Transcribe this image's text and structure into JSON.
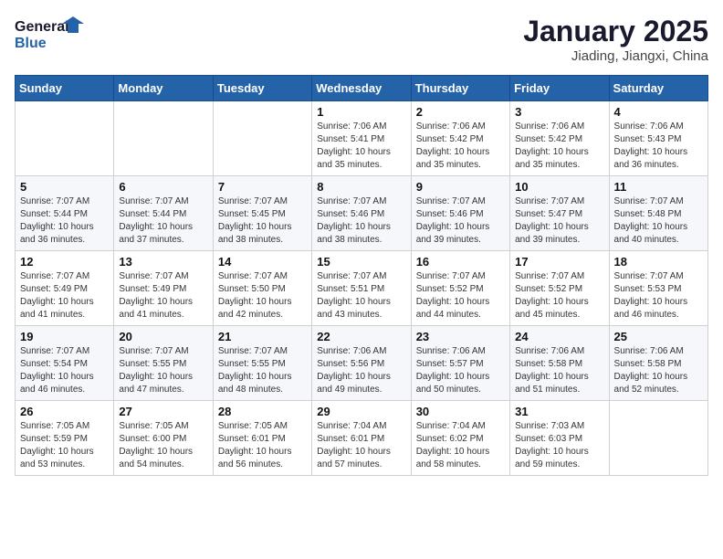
{
  "header": {
    "logo_line1": "General",
    "logo_line2": "Blue",
    "title": "January 2025",
    "subtitle": "Jiading, Jiangxi, China"
  },
  "weekdays": [
    "Sunday",
    "Monday",
    "Tuesday",
    "Wednesday",
    "Thursday",
    "Friday",
    "Saturday"
  ],
  "weeks": [
    [
      {
        "day": "",
        "sunrise": "",
        "sunset": "",
        "daylight": ""
      },
      {
        "day": "",
        "sunrise": "",
        "sunset": "",
        "daylight": ""
      },
      {
        "day": "",
        "sunrise": "",
        "sunset": "",
        "daylight": ""
      },
      {
        "day": "1",
        "sunrise": "Sunrise: 7:06 AM",
        "sunset": "Sunset: 5:41 PM",
        "daylight": "Daylight: 10 hours and 35 minutes."
      },
      {
        "day": "2",
        "sunrise": "Sunrise: 7:06 AM",
        "sunset": "Sunset: 5:42 PM",
        "daylight": "Daylight: 10 hours and 35 minutes."
      },
      {
        "day": "3",
        "sunrise": "Sunrise: 7:06 AM",
        "sunset": "Sunset: 5:42 PM",
        "daylight": "Daylight: 10 hours and 35 minutes."
      },
      {
        "day": "4",
        "sunrise": "Sunrise: 7:06 AM",
        "sunset": "Sunset: 5:43 PM",
        "daylight": "Daylight: 10 hours and 36 minutes."
      }
    ],
    [
      {
        "day": "5",
        "sunrise": "Sunrise: 7:07 AM",
        "sunset": "Sunset: 5:44 PM",
        "daylight": "Daylight: 10 hours and 36 minutes."
      },
      {
        "day": "6",
        "sunrise": "Sunrise: 7:07 AM",
        "sunset": "Sunset: 5:44 PM",
        "daylight": "Daylight: 10 hours and 37 minutes."
      },
      {
        "day": "7",
        "sunrise": "Sunrise: 7:07 AM",
        "sunset": "Sunset: 5:45 PM",
        "daylight": "Daylight: 10 hours and 38 minutes."
      },
      {
        "day": "8",
        "sunrise": "Sunrise: 7:07 AM",
        "sunset": "Sunset: 5:46 PM",
        "daylight": "Daylight: 10 hours and 38 minutes."
      },
      {
        "day": "9",
        "sunrise": "Sunrise: 7:07 AM",
        "sunset": "Sunset: 5:46 PM",
        "daylight": "Daylight: 10 hours and 39 minutes."
      },
      {
        "day": "10",
        "sunrise": "Sunrise: 7:07 AM",
        "sunset": "Sunset: 5:47 PM",
        "daylight": "Daylight: 10 hours and 39 minutes."
      },
      {
        "day": "11",
        "sunrise": "Sunrise: 7:07 AM",
        "sunset": "Sunset: 5:48 PM",
        "daylight": "Daylight: 10 hours and 40 minutes."
      }
    ],
    [
      {
        "day": "12",
        "sunrise": "Sunrise: 7:07 AM",
        "sunset": "Sunset: 5:49 PM",
        "daylight": "Daylight: 10 hours and 41 minutes."
      },
      {
        "day": "13",
        "sunrise": "Sunrise: 7:07 AM",
        "sunset": "Sunset: 5:49 PM",
        "daylight": "Daylight: 10 hours and 41 minutes."
      },
      {
        "day": "14",
        "sunrise": "Sunrise: 7:07 AM",
        "sunset": "Sunset: 5:50 PM",
        "daylight": "Daylight: 10 hours and 42 minutes."
      },
      {
        "day": "15",
        "sunrise": "Sunrise: 7:07 AM",
        "sunset": "Sunset: 5:51 PM",
        "daylight": "Daylight: 10 hours and 43 minutes."
      },
      {
        "day": "16",
        "sunrise": "Sunrise: 7:07 AM",
        "sunset": "Sunset: 5:52 PM",
        "daylight": "Daylight: 10 hours and 44 minutes."
      },
      {
        "day": "17",
        "sunrise": "Sunrise: 7:07 AM",
        "sunset": "Sunset: 5:52 PM",
        "daylight": "Daylight: 10 hours and 45 minutes."
      },
      {
        "day": "18",
        "sunrise": "Sunrise: 7:07 AM",
        "sunset": "Sunset: 5:53 PM",
        "daylight": "Daylight: 10 hours and 46 minutes."
      }
    ],
    [
      {
        "day": "19",
        "sunrise": "Sunrise: 7:07 AM",
        "sunset": "Sunset: 5:54 PM",
        "daylight": "Daylight: 10 hours and 46 minutes."
      },
      {
        "day": "20",
        "sunrise": "Sunrise: 7:07 AM",
        "sunset": "Sunset: 5:55 PM",
        "daylight": "Daylight: 10 hours and 47 minutes."
      },
      {
        "day": "21",
        "sunrise": "Sunrise: 7:07 AM",
        "sunset": "Sunset: 5:55 PM",
        "daylight": "Daylight: 10 hours and 48 minutes."
      },
      {
        "day": "22",
        "sunrise": "Sunrise: 7:06 AM",
        "sunset": "Sunset: 5:56 PM",
        "daylight": "Daylight: 10 hours and 49 minutes."
      },
      {
        "day": "23",
        "sunrise": "Sunrise: 7:06 AM",
        "sunset": "Sunset: 5:57 PM",
        "daylight": "Daylight: 10 hours and 50 minutes."
      },
      {
        "day": "24",
        "sunrise": "Sunrise: 7:06 AM",
        "sunset": "Sunset: 5:58 PM",
        "daylight": "Daylight: 10 hours and 51 minutes."
      },
      {
        "day": "25",
        "sunrise": "Sunrise: 7:06 AM",
        "sunset": "Sunset: 5:58 PM",
        "daylight": "Daylight: 10 hours and 52 minutes."
      }
    ],
    [
      {
        "day": "26",
        "sunrise": "Sunrise: 7:05 AM",
        "sunset": "Sunset: 5:59 PM",
        "daylight": "Daylight: 10 hours and 53 minutes."
      },
      {
        "day": "27",
        "sunrise": "Sunrise: 7:05 AM",
        "sunset": "Sunset: 6:00 PM",
        "daylight": "Daylight: 10 hours and 54 minutes."
      },
      {
        "day": "28",
        "sunrise": "Sunrise: 7:05 AM",
        "sunset": "Sunset: 6:01 PM",
        "daylight": "Daylight: 10 hours and 56 minutes."
      },
      {
        "day": "29",
        "sunrise": "Sunrise: 7:04 AM",
        "sunset": "Sunset: 6:01 PM",
        "daylight": "Daylight: 10 hours and 57 minutes."
      },
      {
        "day": "30",
        "sunrise": "Sunrise: 7:04 AM",
        "sunset": "Sunset: 6:02 PM",
        "daylight": "Daylight: 10 hours and 58 minutes."
      },
      {
        "day": "31",
        "sunrise": "Sunrise: 7:03 AM",
        "sunset": "Sunset: 6:03 PM",
        "daylight": "Daylight: 10 hours and 59 minutes."
      },
      {
        "day": "",
        "sunrise": "",
        "sunset": "",
        "daylight": ""
      }
    ]
  ]
}
